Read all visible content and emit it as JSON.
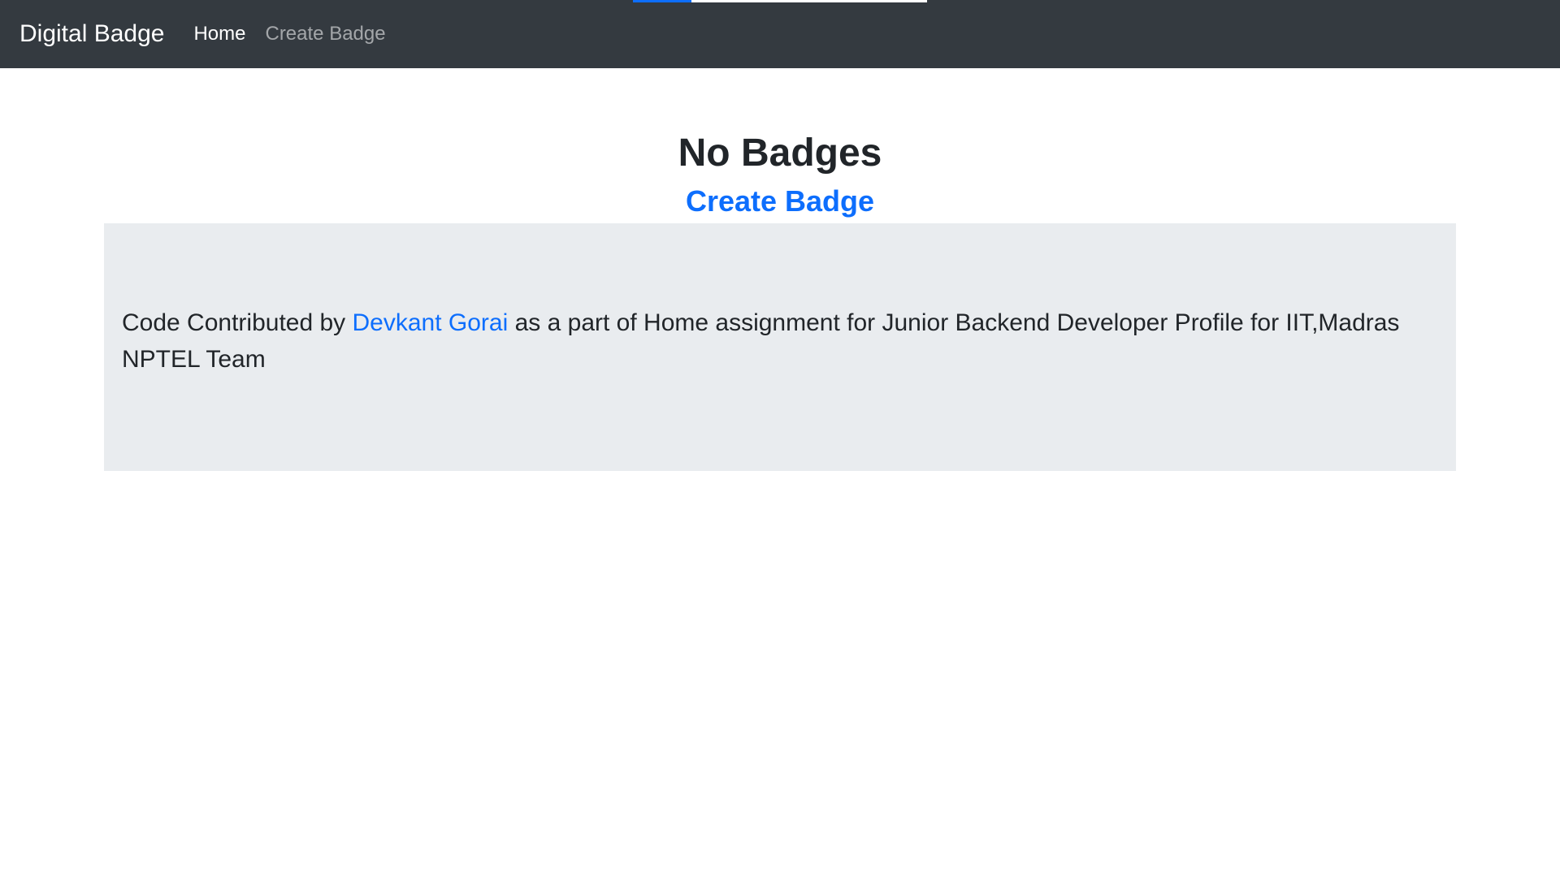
{
  "navbar": {
    "brand": "Digital Badge",
    "links": [
      {
        "label": "Home"
      },
      {
        "label": "Create Badge"
      }
    ],
    "load_progress": 0.2
  },
  "main": {
    "title": "No Badges",
    "create_link": "Create Badge"
  },
  "footer_jumbotron": {
    "text_before": "Code Contributed by ",
    "author_link": "Devkant Gorai",
    "text_after": " as a part of Home assignment for Junior Backend Developer Profile for IIT,Madras NPTEL Team"
  },
  "colors": {
    "navbar_bg": "#343a40",
    "link": "#0d6efd",
    "jumbotron_bg": "#e9ecef"
  }
}
